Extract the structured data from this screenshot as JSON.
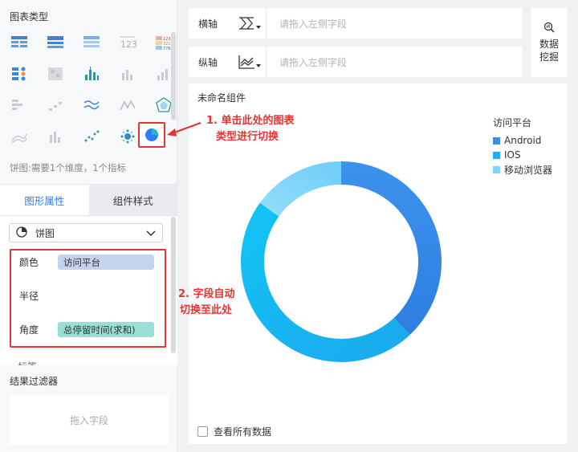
{
  "left_panel": {
    "chart_type_title": "图表类型",
    "chart_type_hint": "饼图:需要1个维度，1个指标",
    "tabs": [
      {
        "label": "图形属性",
        "active": true
      },
      {
        "label": "组件样式",
        "active": false
      }
    ],
    "chart_select": {
      "value": "饼图"
    },
    "properties": [
      {
        "label": "颜色",
        "field": "访问平台"
      },
      {
        "label": "半径",
        "field": ""
      },
      {
        "label": "角度",
        "field": "总停留时间(求和)"
      }
    ],
    "next_property_label": "标签",
    "filter_title": "结果过滤器",
    "filter_placeholder": "拖入字段"
  },
  "axes": {
    "x": {
      "label": "横轴",
      "placeholder": "请拖入左侧字段"
    },
    "y": {
      "label": "纵轴",
      "placeholder": "请拖入左侧字段"
    }
  },
  "mining_button": {
    "line1": "数据",
    "line2": "挖掘"
  },
  "chart_panel": {
    "title": "未命名组件",
    "show_all_label": "查看所有数据"
  },
  "chart_data": {
    "type": "pie",
    "legend_title": "访问平台",
    "legend_position": "top-right",
    "series": [
      {
        "name": "Android",
        "value": 38,
        "color": "#3b8ded"
      },
      {
        "name": "IOS",
        "value": 47,
        "color": "#16b6f0"
      },
      {
        "name": "移动浏览器",
        "value": 15,
        "color": "#7fd4fb"
      }
    ]
  },
  "annotations": {
    "step1_line1": "1. 单击此处的图表",
    "step1_line2": "类型进行切换",
    "step2_line1": "2. 字段自动",
    "step2_line2": "切换至此处"
  },
  "colors": {
    "accent": "#2f7df6",
    "annotation_red": "#e63333"
  }
}
